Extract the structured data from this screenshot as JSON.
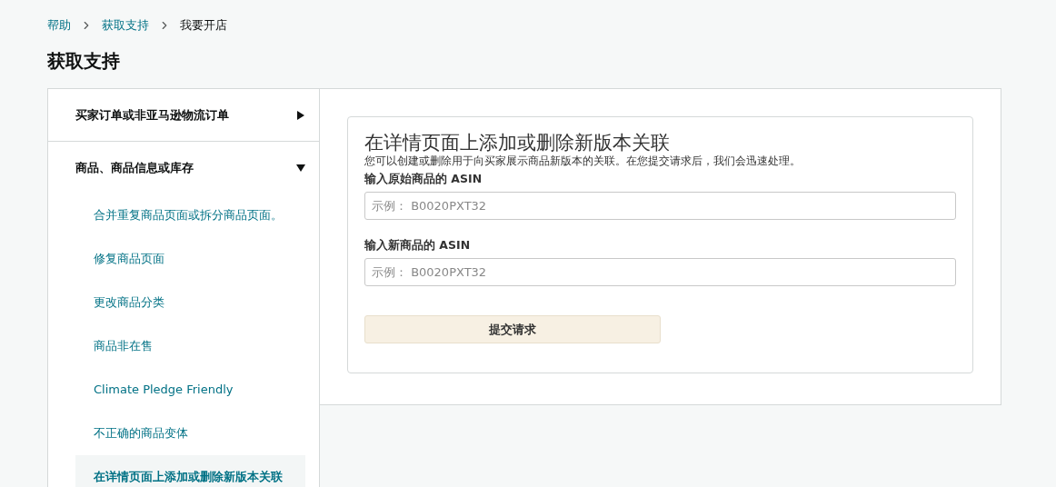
{
  "breadcrumb": [
    {
      "label": "帮助",
      "current": false
    },
    {
      "label": "获取支持",
      "current": false
    },
    {
      "label": "我要开店",
      "current": true
    }
  ],
  "page_title": "获取支持",
  "sidebar": [
    {
      "label": "买家订单或非亚马逊物流订单",
      "expanded": false
    },
    {
      "label": "商品、商品信息或库存",
      "expanded": true,
      "children": [
        {
          "label": "合并重复商品页面或拆分商品页面。",
          "selected": false
        },
        {
          "label": "修复商品页面",
          "selected": false
        },
        {
          "label": "更改商品分类",
          "selected": false
        },
        {
          "label": "商品非在售",
          "selected": false
        },
        {
          "label": "Climate Pledge Friendly",
          "selected": false
        },
        {
          "label": "不正确的商品变体",
          "selected": false
        },
        {
          "label": "在详情页面上添加或删除新版本关联",
          "selected": true
        }
      ]
    }
  ],
  "form": {
    "title": "在详情页面上添加或删除新版本关联",
    "description": "您可以创建或删除用于向买家展示商品新版本的关联。在您提交请求后，我们会迅速处理。",
    "fields": [
      {
        "label": "输入原始商品的 ASIN",
        "placeholder": "示例： B0020PXT32"
      },
      {
        "label": "输入新商品的 ASIN",
        "placeholder": "示例： B0020PXT32"
      }
    ],
    "submit": "提交请求"
  }
}
